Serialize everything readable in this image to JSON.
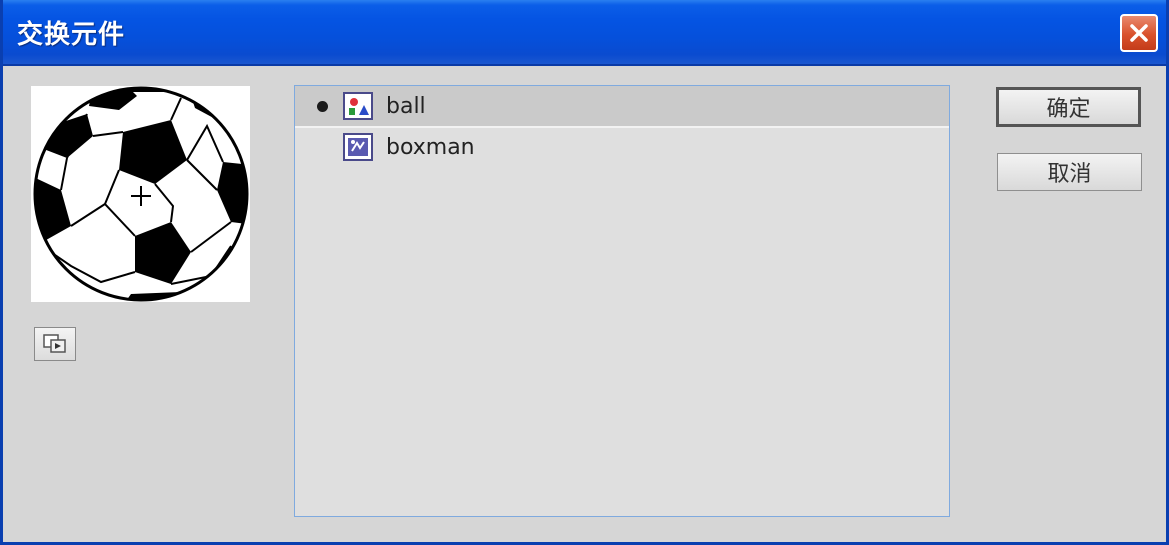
{
  "dialog": {
    "title": "交换元件",
    "close_icon": "close-x-icon"
  },
  "preview": {
    "image": "soccer-ball-preview",
    "toggle_icon": "preview-toggle-icon"
  },
  "symbol_list": {
    "items": [
      {
        "label": "ball",
        "icon": "graphic-symbol-icon",
        "selected": true,
        "current_marker": true
      },
      {
        "label": "boxman",
        "icon": "movieclip-symbol-icon",
        "selected": false,
        "current_marker": false
      }
    ]
  },
  "buttons": {
    "ok_label": "确定",
    "cancel_label": "取消"
  },
  "colors": {
    "titlebar": "#0554e3",
    "close_button": "#d9512c",
    "dialog_bg": "#d6d6d6",
    "list_border": "#7faadf"
  }
}
